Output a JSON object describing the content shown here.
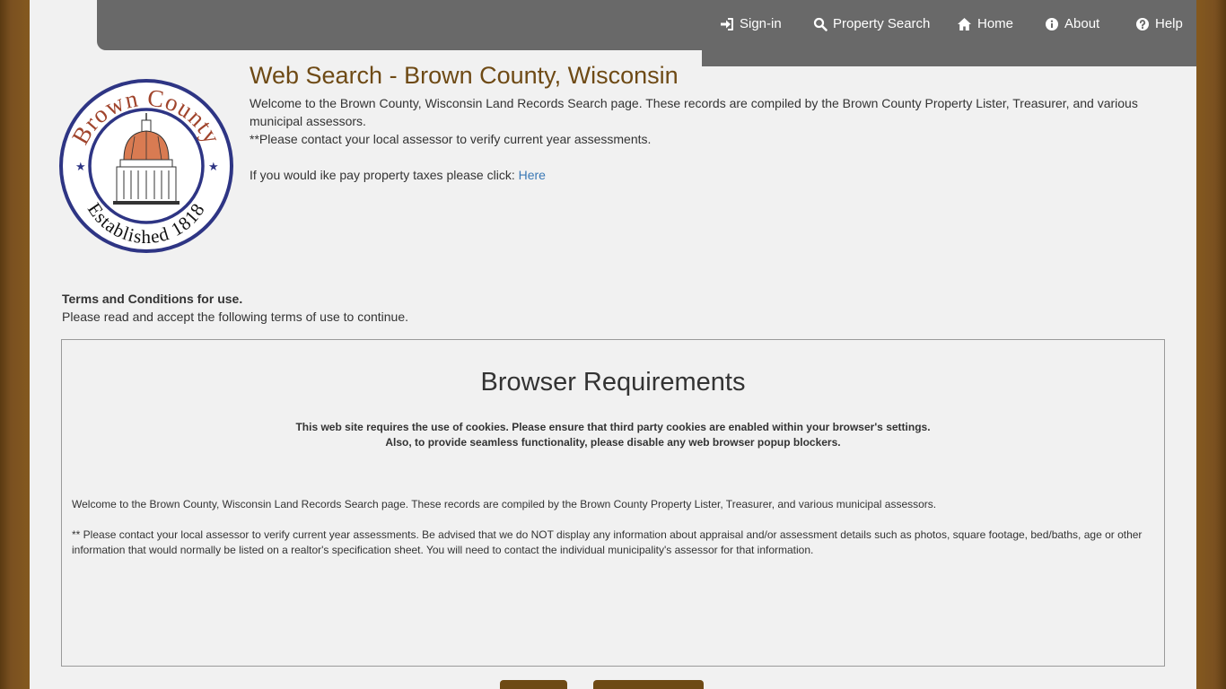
{
  "nav": {
    "signin": "Sign-in",
    "property_search": "Property Search",
    "home": "Home",
    "about": "About",
    "help": "Help"
  },
  "logo": {
    "top_text": "Brown County",
    "bottom_text": "Established 1818"
  },
  "header": {
    "title": "Web Search - Brown County, Wisconsin",
    "intro": "Welcome to the Brown County, Wisconsin Land Records Search page. These records are compiled by the Brown County Property Lister, Treasurer, and various municipal assessors.",
    "assessor_note": "**Please contact your local assessor to verify current year assessments.",
    "tax_prompt": "If you would ike pay property taxes please click: ",
    "tax_link": "Here"
  },
  "terms": {
    "heading": "Terms and Conditions for use.",
    "subheading": "Please read and accept the following terms of use to continue.",
    "box_title": "Browser Requirements",
    "cookies_line": "This web site requires the use of cookies. Please ensure that third party cookies are enabled within your browser's settings.",
    "popup_line": "Also, to provide seamless functionality, please disable any web browser popup blockers.",
    "welcome_para": "Welcome to the Brown County, Wisconsin Land Records Search page. These records are compiled by the Brown County Property Lister, Treasurer, and various municipal assessors.",
    "disclaimer_para": "** Please contact your local assessor to verify current year assessments. Be advised that we do NOT display any information about appraisal and/or assessment details such as photos, square footage, bed/baths, age or other information that would normally be listed on a realtor's specification sheet. You will need to contact the individual municipality's assessor for that information."
  },
  "colors": {
    "brand_brown": "#6e4a15",
    "nav_gray": "#696969",
    "link_blue": "#3a78b5",
    "seal_blue": "#2e3584",
    "seal_red": "#a0442c"
  },
  "icons": [
    "sign-in-icon",
    "search-icon",
    "home-icon",
    "info-icon",
    "help-icon"
  ]
}
